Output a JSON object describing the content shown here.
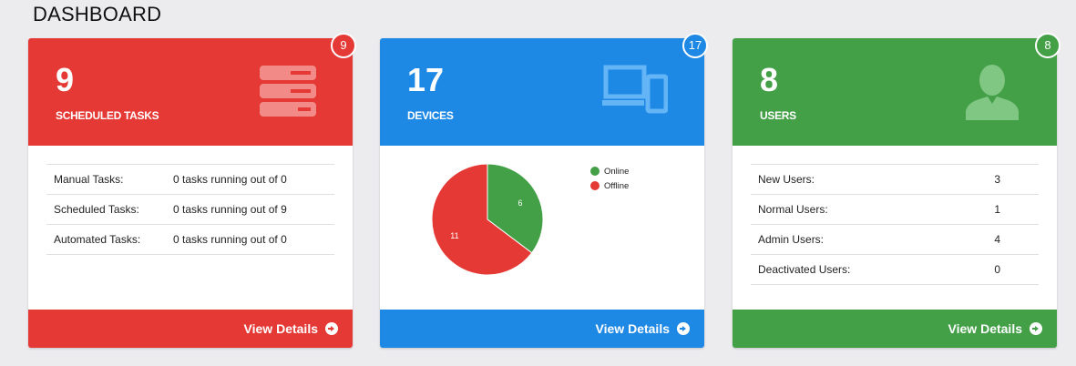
{
  "page": {
    "title": "DASHBOARD"
  },
  "cards": {
    "tasks": {
      "count": "9",
      "badge": "9",
      "label": "SCHEDULED TASKS",
      "rows": [
        {
          "key": "Manual Tasks:",
          "value": "0 tasks running out of 0"
        },
        {
          "key": "Scheduled Tasks:",
          "value": "0 tasks running out of 9"
        },
        {
          "key": "Automated Tasks:",
          "value": "0 tasks running out of 0"
        }
      ],
      "footer": "View Details",
      "color": "#e53935",
      "icon": "server-icon"
    },
    "devices": {
      "count": "17",
      "badge": "17",
      "label": "DEVICES",
      "footer": "View Details",
      "color": "#1e88e5",
      "icon": "devices-icon"
    },
    "users": {
      "count": "8",
      "badge": "8",
      "label": "USERS",
      "rows": [
        {
          "key": "New Users:",
          "value": "3"
        },
        {
          "key": "Normal Users:",
          "value": "1"
        },
        {
          "key": "Admin Users:",
          "value": "4"
        },
        {
          "key": "Deactivated Users:",
          "value": "0"
        }
      ],
      "footer": "View Details",
      "color": "#43a047",
      "icon": "user-icon"
    }
  },
  "chart_data": {
    "type": "pie",
    "categories": [
      "Online",
      "Offline"
    ],
    "values": [
      6,
      11
    ],
    "colors": [
      "#43a047",
      "#e53935"
    ],
    "legend": "top-right"
  }
}
